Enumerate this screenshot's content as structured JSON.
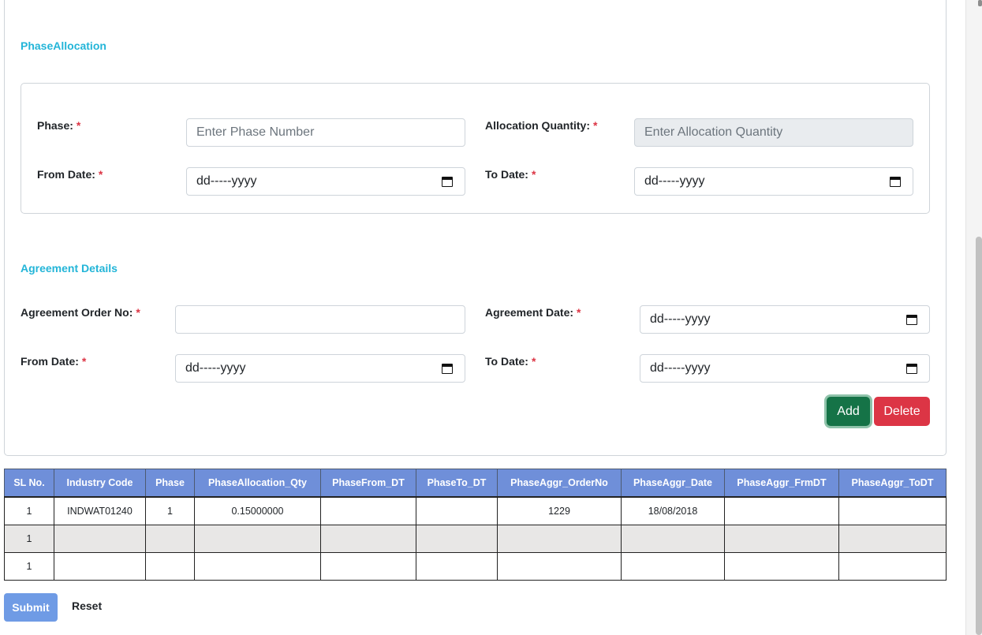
{
  "phase_allocation": {
    "title": "PhaseAllocation",
    "phase_label": "Phase:",
    "phase_placeholder": "Enter Phase Number",
    "alloc_qty_label": "Allocation Quantity:",
    "alloc_qty_placeholder": "Enter Allocation Quantity",
    "from_date_label": "From Date:",
    "from_date_value": "dd-----yyyy",
    "to_date_label": "To Date:",
    "to_date_value": "dd-----yyyy",
    "required_mark": "*"
  },
  "agreement_details": {
    "title": "Agreement Details",
    "order_no_label": "Agreement Order No:",
    "order_no_value": "",
    "agreement_date_label": "Agreement Date:",
    "agreement_date_value": "dd-----yyyy",
    "from_date_label": "From Date:",
    "from_date_value": "dd-----yyyy",
    "to_date_label": "To Date:",
    "to_date_value": "dd-----yyyy",
    "required_mark": "*"
  },
  "buttons": {
    "add": "Add",
    "delete": "Delete",
    "submit": "Submit",
    "reset": "Reset"
  },
  "table": {
    "headers": [
      "SL No.",
      "Industry Code",
      "Phase",
      "PhaseAllocation_Qty",
      "PhaseFrom_DT",
      "PhaseTo_DT",
      "PhaseAggr_OrderNo",
      "PhaseAggr_Date",
      "PhaseAggr_FrmDT",
      "PhaseAggr_ToDT"
    ],
    "rows": [
      [
        "1",
        "INDWAT01240",
        "1",
        "0.15000000",
        "",
        "",
        "1229",
        "18/08/2018",
        "",
        ""
      ],
      [
        "1",
        "",
        "",
        "",
        "",
        "",
        "",
        "",
        "",
        ""
      ],
      [
        "1",
        "",
        "",
        "",
        "",
        "",
        "",
        "",
        "",
        ""
      ]
    ]
  },
  "colors": {
    "section_title": "#23b5d8",
    "required": "#dc3545",
    "add_button": "#157347",
    "delete_button": "#dc3545",
    "table_header": "#6f8fd9",
    "submit_button": "#6f9be5"
  },
  "icons": {
    "date_picker": "calendar-icon"
  }
}
